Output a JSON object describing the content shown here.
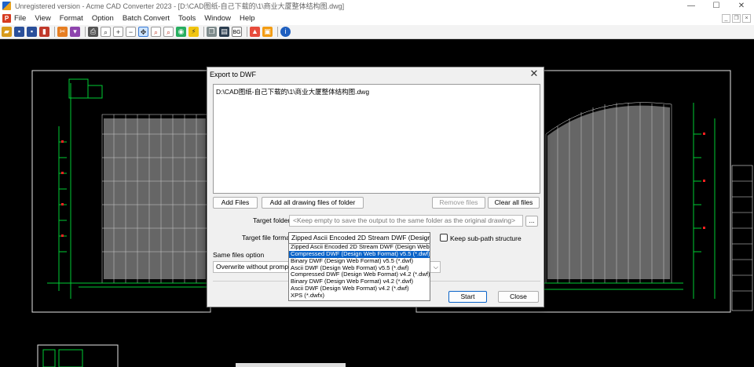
{
  "window": {
    "title": "Unregistered version - Acme CAD Converter 2023 - [D:\\CAD图纸-自己下载的\\1\\商业大厦整体结构图.dwg]",
    "minimize": "—",
    "maximize": "☐",
    "close": "✕"
  },
  "menu": {
    "items": [
      "File",
      "View",
      "Format",
      "Option",
      "Batch Convert",
      "Tools",
      "Window",
      "Help"
    ],
    "mdi_min": "_",
    "mdi_restore": "❐",
    "mdi_close": "×"
  },
  "toolbar": {
    "icons": [
      "open-icon",
      "save-icon",
      "save-all-icon",
      "convert-icon",
      "cut-icon",
      "export-icon",
      "print-icon",
      "zoom-icon",
      "zoom-in-icon",
      "zoom-out-icon",
      "pan-icon",
      "zoom-window-icon",
      "zoom-extents-icon",
      "view-icon",
      "layer-icon",
      "copy-icon",
      "bg-color-icon",
      "line-weight-icon",
      "image-icon",
      "info-icon"
    ],
    "bg_label": "BG"
  },
  "dialog": {
    "title": "Export to DWF",
    "file_path": "D:\\CAD图纸-自己下载的\\1\\商业大厦整体结构图.dwg",
    "add_files": "Add Files",
    "add_folder": "Add all drawing files of folder",
    "remove_files": "Remove files",
    "clear_all": "Clear all files",
    "target_folder_label": "Target folder",
    "target_folder_placeholder": "<Keep empty to save the output to the same folder as the original drawing>",
    "browse": "...",
    "target_format_label": "Target file format",
    "target_format_value": "Zipped Ascii Encoded 2D Stream DWF (Design We",
    "keep_subpath_label": "Keep sub-path structure",
    "same_files_label": "Same files option",
    "same_files_value": "Overwrite without prompt",
    "start": "Start",
    "close": "Close",
    "format_options": [
      "Zipped Ascii Encoded 2D Stream DWF (Design Web Fo",
      "Compressed DWF (Design Web Format) v5.5 (*.dwf)",
      "Binary DWF (Design Web Format) v5.5 (*.dwf)",
      "Ascii DWF (Design Web Format) v5.5 (*.dwf)",
      "Compressed DWF (Design Web Format) v4.2 (*.dwf)",
      "Binary DWF (Design Web Format) v4.2 (*.dwf)",
      "Ascii DWF (Design Web Format) v4.2 (*.dwf)",
      "XPS (*.dwfx)"
    ],
    "selected_option": "Compressed DWF (Design Web Format) v5.5 (*.dwf)"
  },
  "colors": {
    "selection": "#0a63c8",
    "cad_green": "#00cc33",
    "cad_white": "#e6e6e6",
    "cad_red": "#ff2020"
  }
}
